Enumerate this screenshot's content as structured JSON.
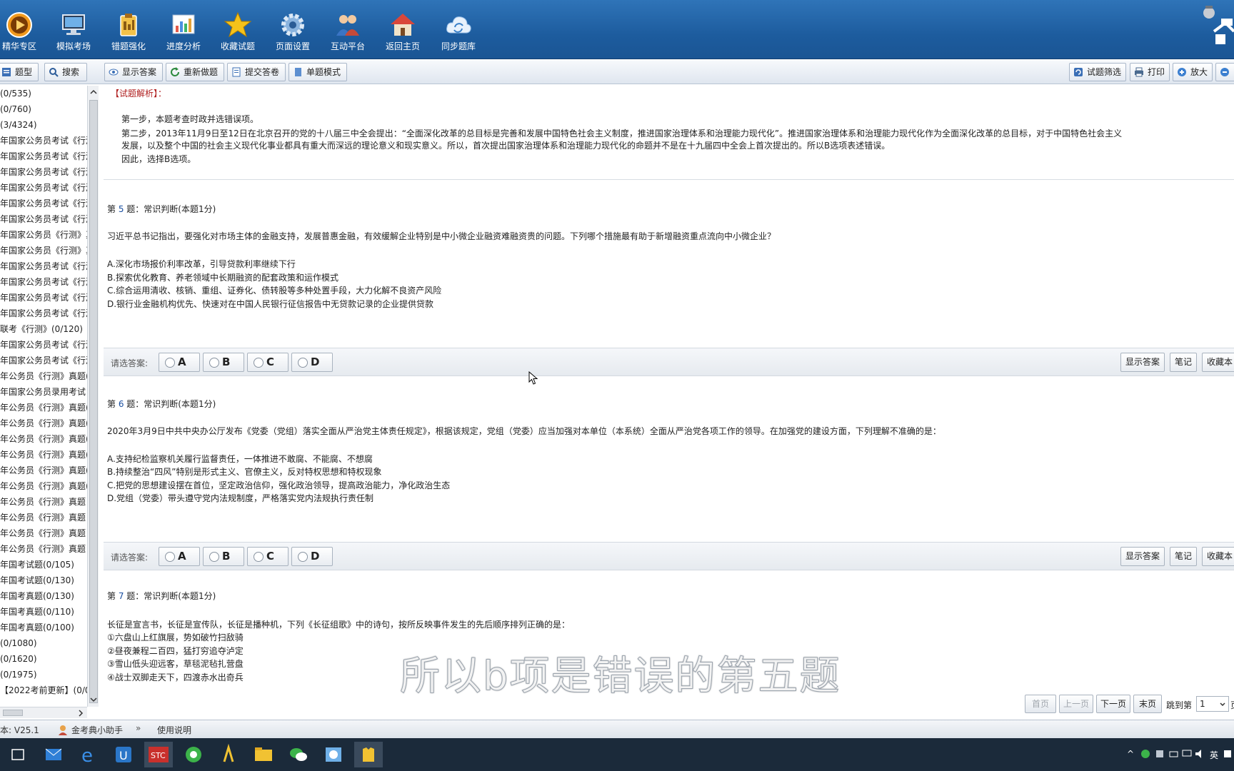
{
  "topnav": [
    {
      "label": "精华专区",
      "icon": "play-icon",
      "x": "0"
    },
    {
      "label": "模拟考场",
      "icon": "computer-icon"
    },
    {
      "label": "错题强化",
      "icon": "clipboard-icon"
    },
    {
      "label": "进度分析",
      "icon": "chart-icon"
    },
    {
      "label": "收藏试题",
      "icon": "star-icon"
    },
    {
      "label": "页面设置",
      "icon": "gear-icon"
    },
    {
      "label": "互动平台",
      "icon": "people-icon"
    },
    {
      "label": "返回主页",
      "icon": "home-icon"
    },
    {
      "label": "同步题库",
      "icon": "cloud-sync-icon"
    }
  ],
  "toolbar": {
    "tab_type": "题型",
    "search": "搜索",
    "show_answer": "显示答案",
    "redo": "重新做题",
    "submit": "提交答卷",
    "single_mode": "单题模式",
    "filter": "试题筛选",
    "print": "打印",
    "zoom_in": "放大"
  },
  "sidebar": [
    "(0/535)",
    "(0/760)",
    "(3/4324)",
    "年国家公务员考试《行测",
    "年国家公务员考试《行测",
    "年国家公务员考试《行测",
    "年国家公务员考试《行测",
    "年国家公务员考试《行测",
    "年国家公务员考试《行测",
    "年国家公务员《行测》真",
    "年国家公务员《行测》真",
    "年国家公务员考试《行测",
    "年国家公务员考试《行测",
    "年国家公务员考试《行测",
    "年国家公务员考试《行测",
    "联考《行测》(0/120)",
    "年国家公务员考试《行测",
    "年国家公务员考试《行测",
    "年公务员《行测》真题(",
    "年国家公务员录用考试《",
    "年公务员《行测》真题(",
    "年公务员《行测》真题(",
    "年公务员《行测》真题(",
    "年公务员《行测》真题(",
    "年公务员《行测》真题(",
    "年公务员《行测》真题(",
    "年公务员《行测》真题 (",
    "年公务员《行测》真题 (",
    "年公务员《行测》真题 (",
    "年公务员《行测》真题 (",
    "年国考试题(0/105)",
    "年国考试题(0/130)",
    "年国考真题(0/130)",
    "年国考真题(0/110)",
    "年国考真题(0/100)",
    "(0/1080)",
    "(0/1620)",
    "(0/1975)",
    "【2022考前更新】(0/0"
  ],
  "analysis": {
    "title": "【试题解析】：",
    "lines": [
      "第一步，本题考查时政并选错误项。",
      "第二步，2013年11月9日至12日在北京召开的党的十八届三中全会提出：“全面深化改革的总目标是完善和发展中国特色社会主义制度，推进国家治理体系和治理能力现代化”。推进国家治理体系和治理能力现代化作为全面深化改革的总目标，对于中国特色社会主义",
      "发展，以及整个中国的社会主义现代化事业都具有重大而深远的理论意义和现实意义。所以，首次提出国家治理体系和治理能力现代化的命题并不是在十九届四中全会上首次提出的。所以B选项表述错误。",
      "因此，选择B选项。"
    ]
  },
  "questions": [
    {
      "prefix": "第 ",
      "num": "5",
      "suffix": " 题：常识判断(本题1分)",
      "text": "习近平总书记指出，要强化对市场主体的金融支持，发展普惠金融，有效缓解企业特别是中小微企业融资难融资贵的问题。下列哪个措施最有助于新增融资重点流向中小微企业？",
      "options": [
        "A.深化市场报价利率改革，引导贷款利率继续下行",
        "B.探索优化教育、养老领域中长期融资的配套政策和运作模式",
        "C.综合运用清收、核销、重组、证券化、债转股等多种处置手段，大力化解不良资产风险",
        "D.银行业金融机构优先、快速对在中国人民银行征信报告中无贷款记录的企业提供贷款"
      ]
    },
    {
      "prefix": "第 ",
      "num": "6",
      "suffix": " 题：常识判断(本题1分)",
      "text": "2020年3月9日中共中央办公厅发布《党委（党组）落实全面从严治党主体责任规定》，根据该规定，党组（党委）应当加强对本单位（本系统）全面从严治党各项工作的领导。在加强党的建设方面，下列理解不准确的是：",
      "options": [
        "A.支持纪检监察机关履行监督责任，一体推进不敢腐、不能腐、不想腐",
        "B.持续整治“四风”特别是形式主义、官僚主义，反对特权思想和特权现象",
        "C.把党的思想建设摆在首位，坚定政治信仰，强化政治领导，提高政治能力，净化政治生态",
        "D.党组（党委）带头遵守党内法规制度，严格落实党内法规执行责任制"
      ]
    },
    {
      "prefix": "第 ",
      "num": "7",
      "suffix": " 题：常识判断(本题1分)",
      "text": "长征是宣言书，长征是宣传队，长征是播种机，下列《长征组歌》中的诗句，按所反映事件发生的先后顺序排列正确的是：",
      "options": [
        "①六盘山上红旗展，势如破竹扫敌骑",
        "②昼夜兼程二百四，猛打穷追夺泸定",
        "③雪山低头迎远客，草毯泥毡扎营盘",
        "④战士双脚走天下，四渡赤水出奇兵"
      ]
    }
  ],
  "answerbar": {
    "label": "请选答案:",
    "choices": [
      "A",
      "B",
      "C",
      "D"
    ],
    "show_answer": "显示答案",
    "note": "笔记",
    "fav": "收藏本"
  },
  "pager": {
    "first": "首页",
    "prev": "上一页",
    "next": "下一页",
    "last": "末页",
    "goto": "跳到第",
    "page": "1",
    "suffix": "页"
  },
  "status": {
    "version": "本: V25.1",
    "helper": "金考典小助手",
    "manual": "使用说明"
  },
  "tray": {
    "ime": "英"
  },
  "subtitle": "所以b项是错误的第五题"
}
